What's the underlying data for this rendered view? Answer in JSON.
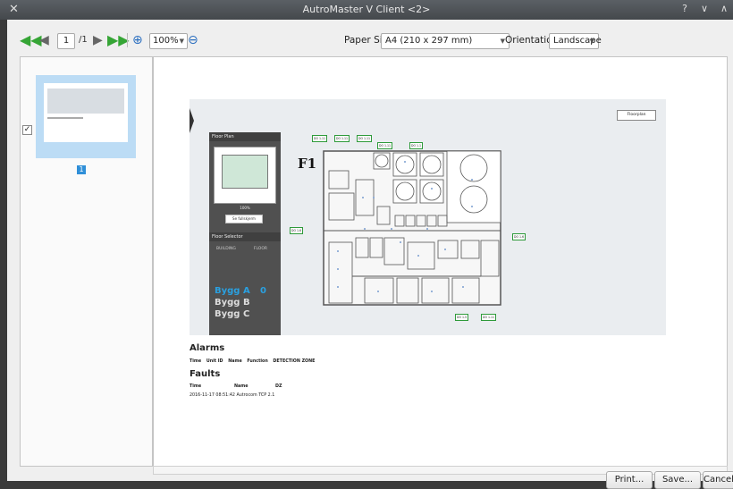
{
  "window": {
    "title": "AutroMaster V Client <2>",
    "controls": [
      "?",
      "∨",
      "∧"
    ]
  },
  "toolbar": {
    "page_current": "1",
    "page_total": "/1",
    "zoom": "100%",
    "paper_label": "Paper Size:",
    "paper_value": "A4 (210 x 297 mm)",
    "orientation_label": "Orientation:",
    "orientation_value": "Landscape"
  },
  "thumbnails": {
    "page_number": "1",
    "checked": "✓"
  },
  "snapshot": {
    "floorplan_button": "Floorplan",
    "side_header": "Floor Plan",
    "zoom_text": "100%",
    "fullscreen_button": "Se fullskjerm",
    "selector_header": "Floor Selector",
    "building_col": "BUILDING",
    "floor_col": "FLOOR",
    "buildings": [
      "Bygg A",
      "Bygg B",
      "Bygg C"
    ],
    "active_floor": "0",
    "floor_label": "F1",
    "detector_tags": [
      "DO 1.11",
      "DO 1.11",
      "DO 1.11",
      "DO 1.11",
      "DO 1.6",
      "DO 1.6",
      "DO 1.5",
      "DO 1.11",
      "DO 1.1"
    ]
  },
  "report": {
    "alarms_title": "Alarms",
    "alarm_columns": [
      "Time",
      "Unit ID",
      "Name",
      "Function",
      "DETECTION ZONE"
    ],
    "faults_title": "Faults",
    "fault_columns": [
      "Time",
      "Name",
      "DZ"
    ],
    "fault_rows": [
      {
        "time": "2016-11-17 08:51:42",
        "name": "Autrocom TCP 2.1",
        "dz": ""
      }
    ]
  },
  "footer": {
    "print": "Print...",
    "save": "Save...",
    "cancel": "Cancel"
  }
}
